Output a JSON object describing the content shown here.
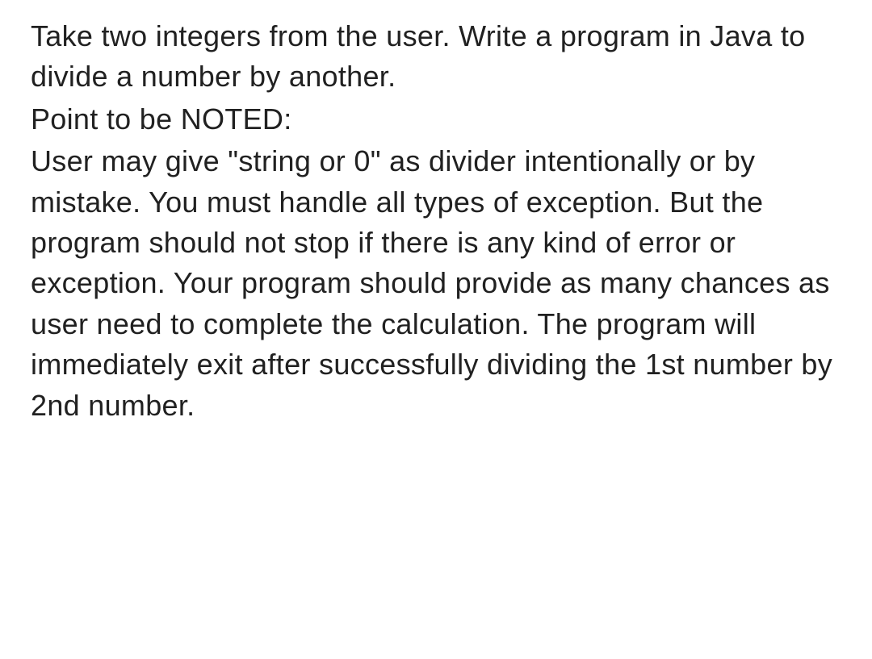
{
  "document": {
    "intro": "Take two integers from the user. Write a program in Java to divide a number by another.",
    "note_heading": "Point to be NOTED:",
    "note_body": "User may give \"string or 0\" as divider intentionally or by mistake. You must handle all types of exception. But the program should not stop if there is any kind of error or exception. Your program should provide as many chances as user need to complete the calculation. The program will immediately exit after successfully dividing the 1st number by 2nd number."
  }
}
